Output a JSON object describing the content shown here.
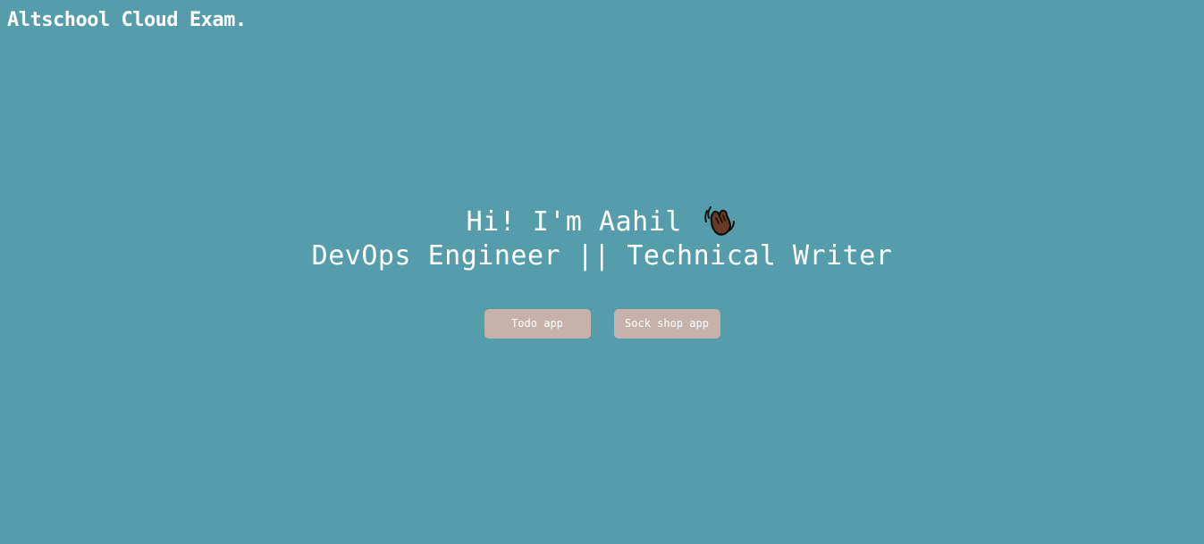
{
  "header": {
    "brand": "Altschool Cloud Exam."
  },
  "hero": {
    "greeting": "Hi! I'm Aahil",
    "greeting_icon": "waving-hand-icon",
    "tagline": "DevOps Engineer || Technical Writer"
  },
  "actions": {
    "todo_label": "Todo app",
    "sock_shop_label": "Sock shop app"
  },
  "colors": {
    "background": "#559dab",
    "button": "#c6b2ab",
    "text": "#ffffff"
  }
}
